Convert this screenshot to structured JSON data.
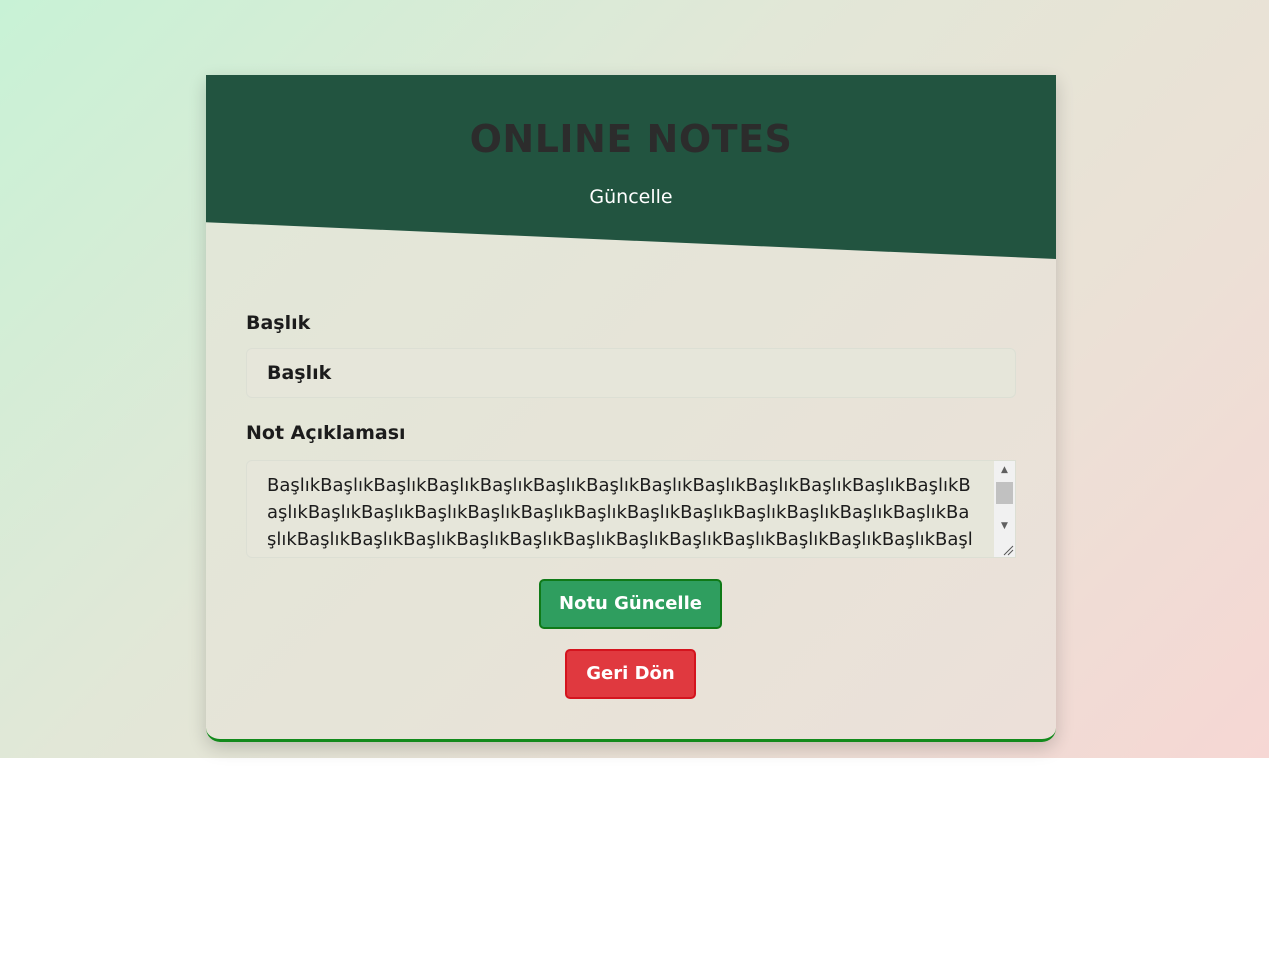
{
  "header": {
    "app_title": "ONLINE NOTES",
    "subtitle": "Güncelle"
  },
  "form": {
    "title_label": "Başlık",
    "title_value": "Başlık",
    "description_label": "Not Açıklaması",
    "description_value": "BaşlıkBaşlıkBaşlıkBaşlıkBaşlıkBaşlıkBaşlıkBaşlıkBaşlıkBaşlıkBaşlıkBaşlıkBaşlıkBaşlıkBaşlıkBaşlıkBaşlıkBaşlıkBaşlıkBaşlıkBaşlıkBaşlıkBaşlıkBaşlıkBaşlıkBaşlıkBaşlıkBaşlıkBaşlıkBaşlıkBaşlıkBaşlıkBaşlıkBaşlıkBaşlıkBaşlıkBaşlıkBaşlıkBaşlıkBaşlıkBa"
  },
  "actions": {
    "update_label": "Notu Güncelle",
    "back_label": "Geri Dön"
  },
  "colors": {
    "header_bg": "#225440",
    "update_button": "#2f9e5f",
    "back_button": "#e0393f",
    "card_border": "#138a1c"
  }
}
